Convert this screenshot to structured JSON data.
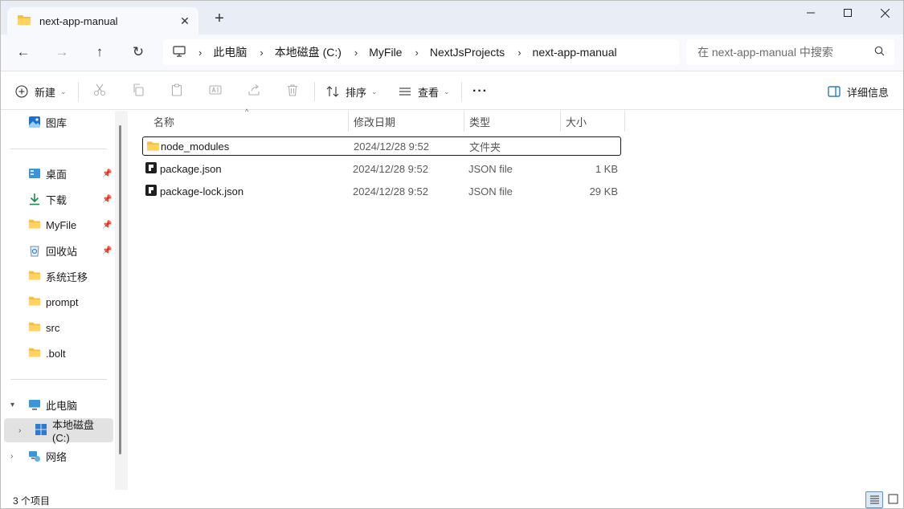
{
  "tab": {
    "title": "next-app-manual",
    "close": "✕",
    "new_tab": "+"
  },
  "window_controls": {
    "minimize": "—",
    "maximize": "☐",
    "close": "✕"
  },
  "nav": {
    "back": "←",
    "forward": "→",
    "up": "↑",
    "refresh": "↻",
    "breadcrumbs": [
      "此电脑",
      "本地磁盘 (C:)",
      "MyFile",
      "NextJsProjects",
      "next-app-manual"
    ],
    "search_placeholder": "在 next-app-manual 中搜索"
  },
  "toolbar": {
    "new_label": "新建",
    "sort_label": "排序",
    "view_label": "查看",
    "more_label": "···",
    "details_label": "详细信息"
  },
  "sidebar": {
    "gallery": "图库",
    "quick_access": [
      {
        "label": "桌面",
        "icon": "desktop-icon",
        "pinned": true
      },
      {
        "label": "下载",
        "icon": "download-icon",
        "pinned": true
      },
      {
        "label": "MyFile",
        "icon": "folder-icon",
        "pinned": true
      },
      {
        "label": "回收站",
        "icon": "recycle-bin-icon",
        "pinned": true
      },
      {
        "label": "系统迁移",
        "icon": "folder-icon",
        "pinned": false
      },
      {
        "label": "prompt",
        "icon": "folder-icon",
        "pinned": false
      },
      {
        "label": "src",
        "icon": "folder-icon",
        "pinned": false
      },
      {
        "label": ".bolt",
        "icon": "folder-icon",
        "pinned": false
      }
    ],
    "this_pc": "此电脑",
    "local_disk": "本地磁盘 (C:)",
    "network": "网络"
  },
  "table": {
    "columns": [
      "名称",
      "修改日期",
      "类型",
      "大小"
    ],
    "rows": [
      {
        "name": "node_modules",
        "date": "2024/12/28 9:52",
        "type": "文件夹",
        "size": "",
        "icon": "folder-icon"
      },
      {
        "name": "package.json",
        "date": "2024/12/28 9:52",
        "type": "JSON file",
        "size": "1 KB",
        "icon": "json-file-icon"
      },
      {
        "name": "package-lock.json",
        "date": "2024/12/28 9:52",
        "type": "JSON file",
        "size": "29 KB",
        "icon": "json-file-icon"
      }
    ]
  },
  "status": {
    "item_count": "3 个项目"
  },
  "colors": {
    "folder": "#f5c042",
    "accent": "#0067c0",
    "titlebar": "#e9eef6"
  }
}
